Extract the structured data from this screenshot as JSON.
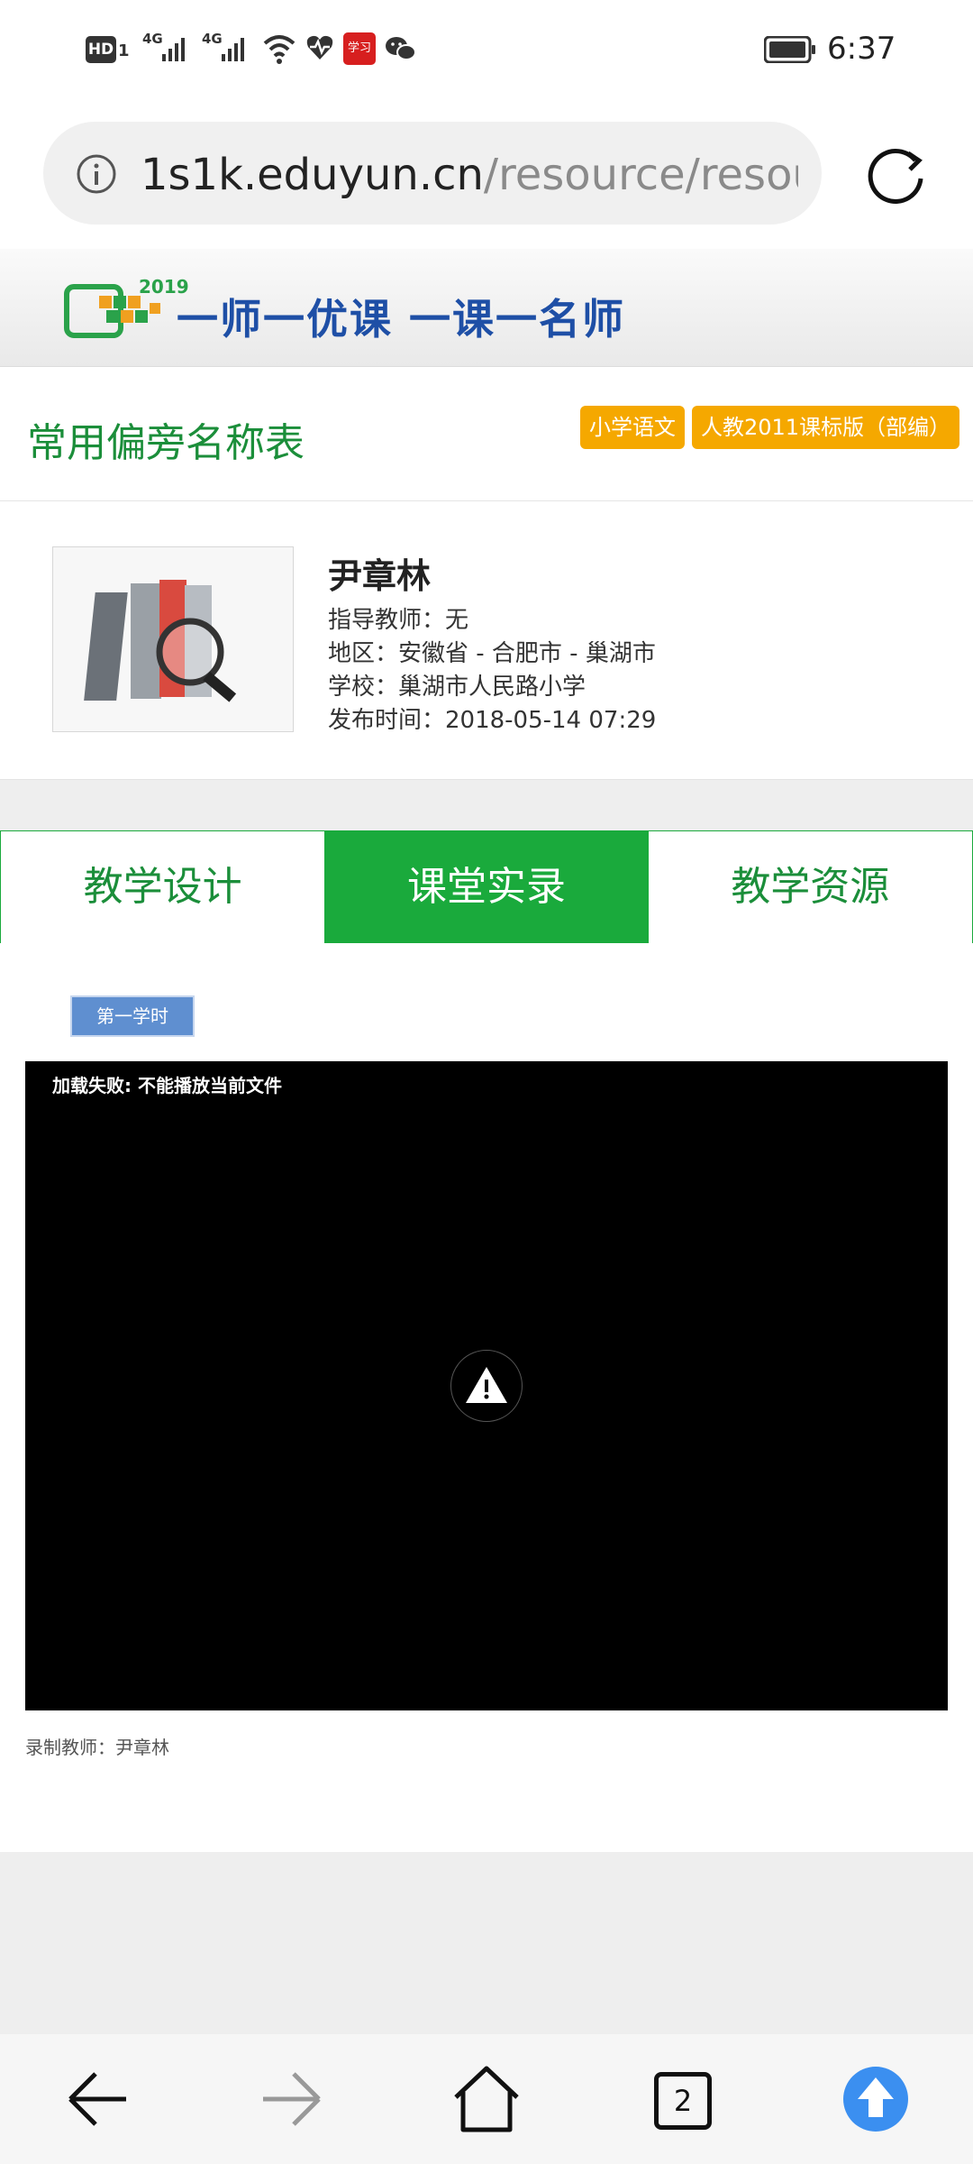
{
  "status_bar": {
    "left_icons": [
      "hd-icon",
      "sim-1-icon",
      "signal-4g-icon",
      "signal-4g-icon",
      "wifi-icon",
      "health-icon",
      "xuexi-app-icon",
      "wechat-icon"
    ],
    "network_label_1": "4G",
    "network_label_2": "4G",
    "sim_label": "1",
    "hd_label": "HD",
    "app_badge": "学习",
    "time": "6:37"
  },
  "browser": {
    "url_domain": "1s1k.eduyun.cn",
    "url_path": "/resource/resource",
    "info_icon": "info-icon",
    "reload_icon": "reload-icon"
  },
  "banner": {
    "year": "2019",
    "slogan": "一师一优课  一课一名师"
  },
  "lesson": {
    "title": "常用偏旁名称表",
    "tags": [
      "小学语文",
      "人教2011课标版（部编）"
    ]
  },
  "teacher": {
    "name": "尹章林",
    "advisor": "指导教师：无",
    "region": "地区：安徽省 - 合肥市 - 巢湖市",
    "school": "学校：巢湖市人民路小学",
    "published": "发布时间：2018-05-14 07:29"
  },
  "tabs": [
    {
      "label": "教学设计",
      "active": false
    },
    {
      "label": "课堂实录",
      "active": true
    },
    {
      "label": "教学资源",
      "active": false
    }
  ],
  "content": {
    "lesson_button": "第一学时",
    "video_error": "加载失败: 不能播放当前文件",
    "recorder": "录制教师：尹章林"
  },
  "bottom_nav": {
    "back_icon": "back-arrow-icon",
    "forward_icon": "forward-arrow-icon",
    "home_icon": "home-icon",
    "tab_count": "2",
    "upload_icon": "upload-icon"
  },
  "colors": {
    "green": "#1aaa3c",
    "title_green": "#1b8e3a",
    "tag_orange": "#f5a800",
    "blue_button": "#3b8ff0",
    "lesson_blue": "#5f8fd0"
  }
}
